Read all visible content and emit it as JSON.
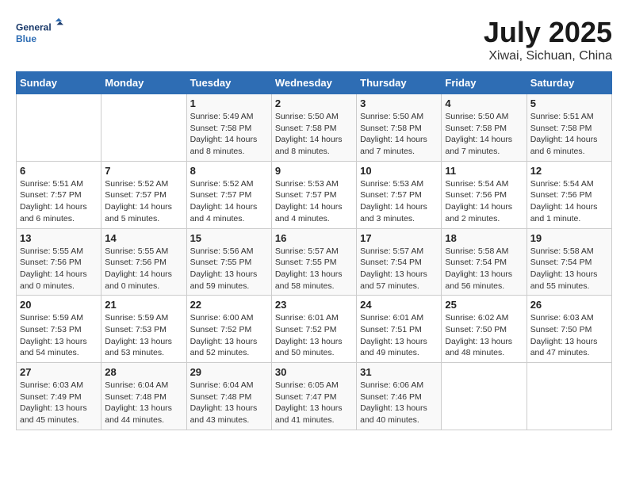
{
  "header": {
    "logo_line1": "General",
    "logo_line2": "Blue",
    "month": "July 2025",
    "location": "Xiwai, Sichuan, China"
  },
  "weekdays": [
    "Sunday",
    "Monday",
    "Tuesday",
    "Wednesday",
    "Thursday",
    "Friday",
    "Saturday"
  ],
  "weeks": [
    [
      {
        "day": "",
        "sunrise": "",
        "sunset": "",
        "daylight": ""
      },
      {
        "day": "",
        "sunrise": "",
        "sunset": "",
        "daylight": ""
      },
      {
        "day": "1",
        "sunrise": "Sunrise: 5:49 AM",
        "sunset": "Sunset: 7:58 PM",
        "daylight": "Daylight: 14 hours and 8 minutes."
      },
      {
        "day": "2",
        "sunrise": "Sunrise: 5:50 AM",
        "sunset": "Sunset: 7:58 PM",
        "daylight": "Daylight: 14 hours and 8 minutes."
      },
      {
        "day": "3",
        "sunrise": "Sunrise: 5:50 AM",
        "sunset": "Sunset: 7:58 PM",
        "daylight": "Daylight: 14 hours and 7 minutes."
      },
      {
        "day": "4",
        "sunrise": "Sunrise: 5:50 AM",
        "sunset": "Sunset: 7:58 PM",
        "daylight": "Daylight: 14 hours and 7 minutes."
      },
      {
        "day": "5",
        "sunrise": "Sunrise: 5:51 AM",
        "sunset": "Sunset: 7:58 PM",
        "daylight": "Daylight: 14 hours and 6 minutes."
      }
    ],
    [
      {
        "day": "6",
        "sunrise": "Sunrise: 5:51 AM",
        "sunset": "Sunset: 7:57 PM",
        "daylight": "Daylight: 14 hours and 6 minutes."
      },
      {
        "day": "7",
        "sunrise": "Sunrise: 5:52 AM",
        "sunset": "Sunset: 7:57 PM",
        "daylight": "Daylight: 14 hours and 5 minutes."
      },
      {
        "day": "8",
        "sunrise": "Sunrise: 5:52 AM",
        "sunset": "Sunset: 7:57 PM",
        "daylight": "Daylight: 14 hours and 4 minutes."
      },
      {
        "day": "9",
        "sunrise": "Sunrise: 5:53 AM",
        "sunset": "Sunset: 7:57 PM",
        "daylight": "Daylight: 14 hours and 4 minutes."
      },
      {
        "day": "10",
        "sunrise": "Sunrise: 5:53 AM",
        "sunset": "Sunset: 7:57 PM",
        "daylight": "Daylight: 14 hours and 3 minutes."
      },
      {
        "day": "11",
        "sunrise": "Sunrise: 5:54 AM",
        "sunset": "Sunset: 7:56 PM",
        "daylight": "Daylight: 14 hours and 2 minutes."
      },
      {
        "day": "12",
        "sunrise": "Sunrise: 5:54 AM",
        "sunset": "Sunset: 7:56 PM",
        "daylight": "Daylight: 14 hours and 1 minute."
      }
    ],
    [
      {
        "day": "13",
        "sunrise": "Sunrise: 5:55 AM",
        "sunset": "Sunset: 7:56 PM",
        "daylight": "Daylight: 14 hours and 0 minutes."
      },
      {
        "day": "14",
        "sunrise": "Sunrise: 5:55 AM",
        "sunset": "Sunset: 7:56 PM",
        "daylight": "Daylight: 14 hours and 0 minutes."
      },
      {
        "day": "15",
        "sunrise": "Sunrise: 5:56 AM",
        "sunset": "Sunset: 7:55 PM",
        "daylight": "Daylight: 13 hours and 59 minutes."
      },
      {
        "day": "16",
        "sunrise": "Sunrise: 5:57 AM",
        "sunset": "Sunset: 7:55 PM",
        "daylight": "Daylight: 13 hours and 58 minutes."
      },
      {
        "day": "17",
        "sunrise": "Sunrise: 5:57 AM",
        "sunset": "Sunset: 7:54 PM",
        "daylight": "Daylight: 13 hours and 57 minutes."
      },
      {
        "day": "18",
        "sunrise": "Sunrise: 5:58 AM",
        "sunset": "Sunset: 7:54 PM",
        "daylight": "Daylight: 13 hours and 56 minutes."
      },
      {
        "day": "19",
        "sunrise": "Sunrise: 5:58 AM",
        "sunset": "Sunset: 7:54 PM",
        "daylight": "Daylight: 13 hours and 55 minutes."
      }
    ],
    [
      {
        "day": "20",
        "sunrise": "Sunrise: 5:59 AM",
        "sunset": "Sunset: 7:53 PM",
        "daylight": "Daylight: 13 hours and 54 minutes."
      },
      {
        "day": "21",
        "sunrise": "Sunrise: 5:59 AM",
        "sunset": "Sunset: 7:53 PM",
        "daylight": "Daylight: 13 hours and 53 minutes."
      },
      {
        "day": "22",
        "sunrise": "Sunrise: 6:00 AM",
        "sunset": "Sunset: 7:52 PM",
        "daylight": "Daylight: 13 hours and 52 minutes."
      },
      {
        "day": "23",
        "sunrise": "Sunrise: 6:01 AM",
        "sunset": "Sunset: 7:52 PM",
        "daylight": "Daylight: 13 hours and 50 minutes."
      },
      {
        "day": "24",
        "sunrise": "Sunrise: 6:01 AM",
        "sunset": "Sunset: 7:51 PM",
        "daylight": "Daylight: 13 hours and 49 minutes."
      },
      {
        "day": "25",
        "sunrise": "Sunrise: 6:02 AM",
        "sunset": "Sunset: 7:50 PM",
        "daylight": "Daylight: 13 hours and 48 minutes."
      },
      {
        "day": "26",
        "sunrise": "Sunrise: 6:03 AM",
        "sunset": "Sunset: 7:50 PM",
        "daylight": "Daylight: 13 hours and 47 minutes."
      }
    ],
    [
      {
        "day": "27",
        "sunrise": "Sunrise: 6:03 AM",
        "sunset": "Sunset: 7:49 PM",
        "daylight": "Daylight: 13 hours and 45 minutes."
      },
      {
        "day": "28",
        "sunrise": "Sunrise: 6:04 AM",
        "sunset": "Sunset: 7:48 PM",
        "daylight": "Daylight: 13 hours and 44 minutes."
      },
      {
        "day": "29",
        "sunrise": "Sunrise: 6:04 AM",
        "sunset": "Sunset: 7:48 PM",
        "daylight": "Daylight: 13 hours and 43 minutes."
      },
      {
        "day": "30",
        "sunrise": "Sunrise: 6:05 AM",
        "sunset": "Sunset: 7:47 PM",
        "daylight": "Daylight: 13 hours and 41 minutes."
      },
      {
        "day": "31",
        "sunrise": "Sunrise: 6:06 AM",
        "sunset": "Sunset: 7:46 PM",
        "daylight": "Daylight: 13 hours and 40 minutes."
      },
      {
        "day": "",
        "sunrise": "",
        "sunset": "",
        "daylight": ""
      },
      {
        "day": "",
        "sunrise": "",
        "sunset": "",
        "daylight": ""
      }
    ]
  ]
}
